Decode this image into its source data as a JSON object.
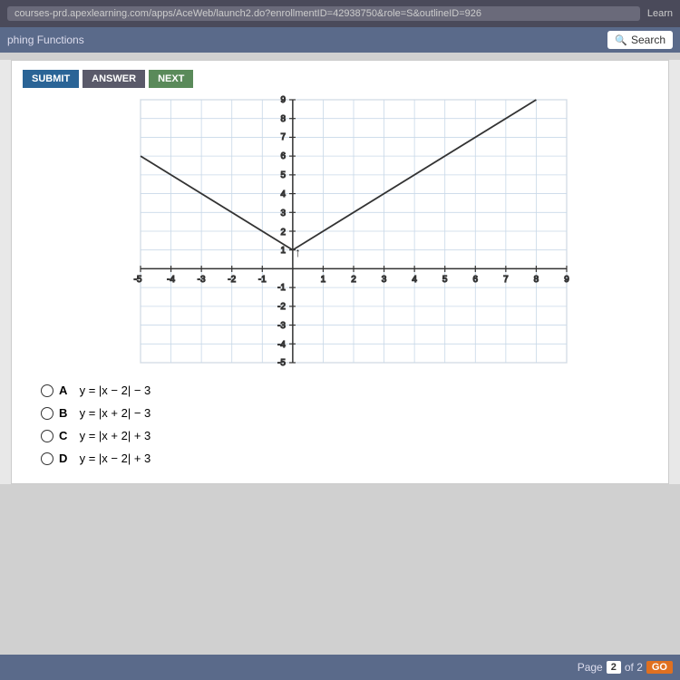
{
  "browser": {
    "url": "courses-prd.apexlearning.com/apps/AceWeb/launch2.do?enrollmentID=42938750&role=S&outlineID=926",
    "learn_label": "Learn"
  },
  "secondary_bar": {
    "title": "phing Functions",
    "search_placeholder": "Search"
  },
  "toolbar": {
    "submit_label": "SUBMIT",
    "answer_label": "ANSWER",
    "next_label": "NEXT"
  },
  "graph": {
    "x_min": -5,
    "x_max": 9,
    "y_min": -5,
    "y_max": 9,
    "vertex_x": 0,
    "vertex_y": 1
  },
  "answers": [
    {
      "id": "A",
      "text": "y = |x − 2| − 3"
    },
    {
      "id": "B",
      "text": "y = |x + 2| − 3"
    },
    {
      "id": "C",
      "text": "y = |x + 2| + 3"
    },
    {
      "id": "D",
      "text": "y = |x − 2| + 3"
    }
  ],
  "pagination": {
    "page_label": "Page",
    "current_page": "2",
    "of_label": "of 2",
    "go_label": "GO"
  }
}
